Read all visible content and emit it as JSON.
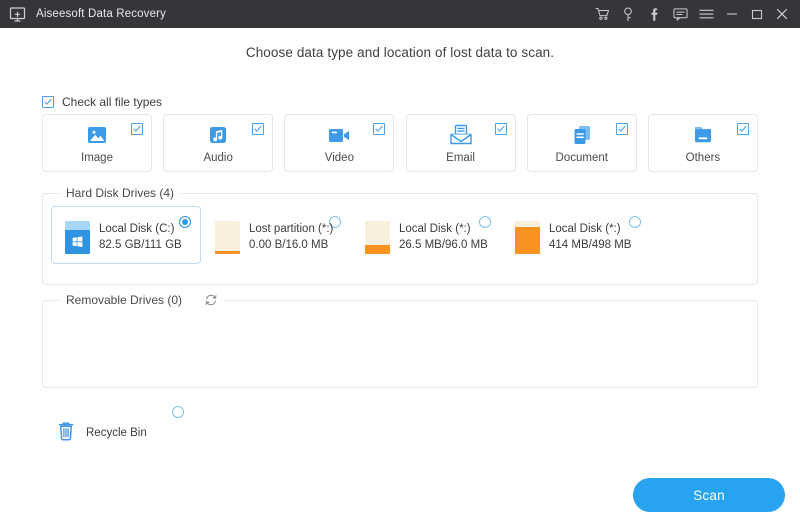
{
  "window": {
    "title": "Aiseesoft Data Recovery",
    "app_icon": "monitor-plus-icon",
    "titlebar_bg": "#35363a",
    "controls": [
      {
        "name": "cart-icon",
        "label": "Cart"
      },
      {
        "name": "key-icon",
        "label": "Register"
      },
      {
        "name": "facebook-icon",
        "label": "Facebook"
      },
      {
        "name": "feedback-icon",
        "label": "Feedback"
      },
      {
        "name": "menu-icon",
        "label": "Menu"
      },
      {
        "name": "minimize-icon",
        "label": "Minimize"
      },
      {
        "name": "maximize-icon",
        "label": "Maximize"
      },
      {
        "name": "close-icon",
        "label": "Close"
      }
    ]
  },
  "main": {
    "headline": "Choose data type and location of lost data to scan.",
    "check_all": {
      "label": "Check all file types",
      "checked": true
    },
    "accent_color": "#27a3f0",
    "file_types": [
      {
        "label": "Image",
        "icon": "image-icon",
        "checked": true
      },
      {
        "label": "Audio",
        "icon": "audio-icon",
        "checked": true
      },
      {
        "label": "Video",
        "icon": "video-icon",
        "checked": true
      },
      {
        "label": "Email",
        "icon": "email-icon",
        "checked": true
      },
      {
        "label": "Document",
        "icon": "document-icon",
        "checked": true
      },
      {
        "label": "Others",
        "icon": "folder-icon",
        "checked": true
      }
    ],
    "hard_disk_drives": {
      "legend": "Hard Disk Drives (4)",
      "items": [
        {
          "name": "Local Disk (C:)",
          "size": "82.5 GB/111 GB",
          "selected": true,
          "used_percent": 74,
          "color": "#2f93e0",
          "free_color": "#a8d6f5",
          "has_windows_logo": true
        },
        {
          "name": "Lost partition (*:)",
          "size": "0.00  B/16.0 MB",
          "selected": false,
          "used_percent": 4,
          "color": "#f7931e",
          "free_color": "#faeedc",
          "has_windows_logo": false
        },
        {
          "name": "Local Disk (*:)",
          "size": "26.5 MB/96.0 MB",
          "selected": false,
          "used_percent": 28,
          "color": "#f7931e",
          "free_color": "#faeedc",
          "has_windows_logo": false
        },
        {
          "name": "Local Disk (*:)",
          "size": "414 MB/498 MB",
          "selected": false,
          "used_percent": 83,
          "color": "#f7931e",
          "free_color": "#faeedc",
          "has_windows_logo": false
        }
      ]
    },
    "removable_drives": {
      "legend": "Removable Drives (0)",
      "refresh_icon": "refresh-icon",
      "items": []
    },
    "recycle_bin": {
      "label": "Recycle Bin",
      "icon": "trash-icon",
      "selected": false
    },
    "scan_button": {
      "label": "Scan"
    }
  }
}
